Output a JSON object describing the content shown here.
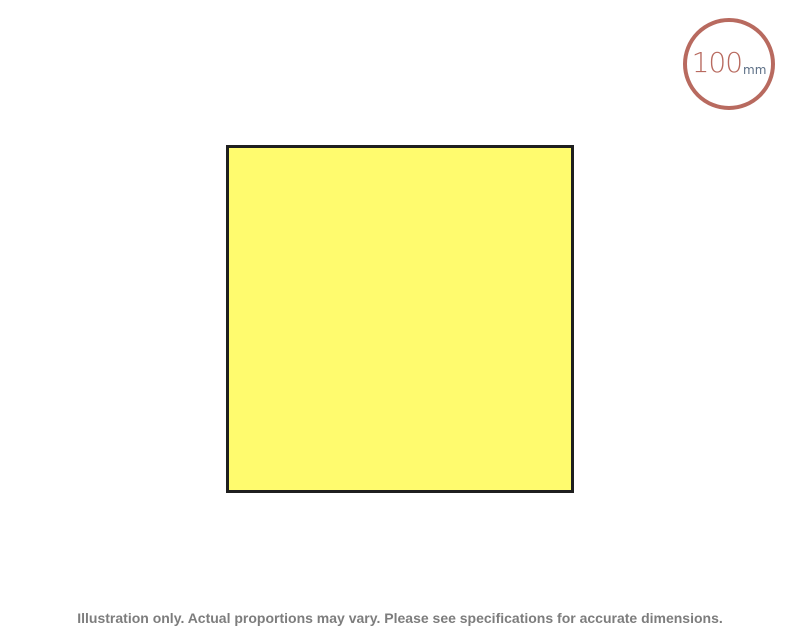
{
  "size_badge": {
    "value": "100",
    "unit": "mm",
    "colors": {
      "ring": "#b86a5f",
      "value": "#b86a5f",
      "unit": "#5c6f86"
    }
  },
  "product": {
    "shape": "square",
    "fill_color": "#fffb6e",
    "border_color": "#1f1f1f"
  },
  "footer": {
    "disclaimer": "Illustration only. Actual proportions may vary. Please see specifications for accurate dimensions."
  }
}
